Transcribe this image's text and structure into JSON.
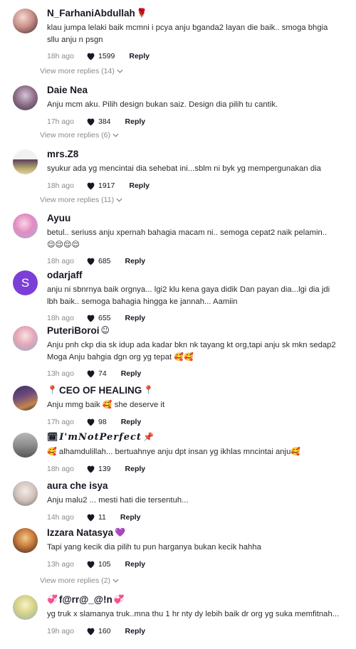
{
  "comments": [
    {
      "username": "N_FarhaniAbdullah",
      "user_emoji": "🌹",
      "text": "klau jumpa lelaki baik mcmni i pcya anju bganda2 layan die baik.. smoga bhgia sllu anju n psgn",
      "time": "18h ago",
      "likes": "1599",
      "reply": "Reply",
      "more": "View more replies (14)"
    },
    {
      "username": "Daie Nea",
      "text": "Anju mcm aku. Pilih design bukan saiz. Design dia pilih tu cantik.",
      "time": "17h ago",
      "likes": "384",
      "reply": "Reply",
      "more": "View more replies (6)"
    },
    {
      "username": "mrs.Z8",
      "text": "syukur ada yg mencintai dia sehebat ini...sblm ni byk yg mempergunakan dia",
      "time": "18h ago",
      "likes": "1917",
      "reply": "Reply",
      "more": "View more replies (11)"
    },
    {
      "username": "Ayuu",
      "text": "betul.. seriuss anju xpernah bahagia macam ni.. semoga cepat2 naik pelamin..",
      "text_emoji": "😌😌😌😌",
      "time": "18h ago",
      "likes": "685",
      "reply": "Reply"
    },
    {
      "username": "odarjaff",
      "avatar_letter": "S",
      "text": "anju ni sbnrnya baik orgnya... lgi2 klu kena gaya didik Dan payan dia...lgi dia jdi lbh baik.. semoga bahagia hingga ke jannah... Aamiin",
      "time": "18h ago",
      "likes": "655",
      "reply": "Reply"
    },
    {
      "username": "PuteriBoroi",
      "user_emoji": "☺",
      "text": "Anju pnh ckp dia sk idup ada kadar bkn nk tayang kt org,tapi anju sk mkn sedap2 Moga Anju bahgia dgn org yg tepat",
      "text_emoji": "🥰🥰",
      "time": "13h ago",
      "likes": "74",
      "reply": "Reply"
    },
    {
      "username": "CEO OF HEALING",
      "user_emoji_pre": "📍",
      "user_emoji": "📍",
      "text": "Anju mmg baik",
      "text_emoji_mid": "🥰",
      "text_after": "she deserve it",
      "time": "17h ago",
      "likes": "98",
      "reply": "Reply"
    },
    {
      "username": "I'mNotPerfect",
      "user_emoji_pre": "🗓",
      "user_emoji": "📌",
      "text_emoji_pre": "🥰",
      "text": "alhamdulillah... bertuahnye anju dpt insan yg ikhlas mncintai anju",
      "text_emoji": "🥰",
      "time": "18h ago",
      "likes": "139",
      "reply": "Reply"
    },
    {
      "username": "aura che isya",
      "text": "Anju malu2 ... mesti hati die tersentuh...",
      "time": "14h ago",
      "likes": "11",
      "reply": "Reply"
    },
    {
      "username": "Izzara Natasya",
      "user_emoji": "💜",
      "text": "Tapi yang kecik dia pilih tu pun harganya bukan kecik hahha",
      "time": "13h ago",
      "likes": "105",
      "reply": "Reply",
      "more": "View more replies (2)"
    },
    {
      "username": "f@rr@_@!n",
      "user_emoji_pre": "💞",
      "user_emoji": "💞",
      "text": "yg truk x slamanya truk..mna thu 1 hr nty dy lebih baik dr org yg suka memfitnah...",
      "time": "19h ago",
      "likes": "160",
      "reply": "Reply"
    }
  ],
  "colors": {
    "text": "#161823",
    "muted": "#8a8b91",
    "avatar_letter_bg": "#7b3fd6"
  }
}
